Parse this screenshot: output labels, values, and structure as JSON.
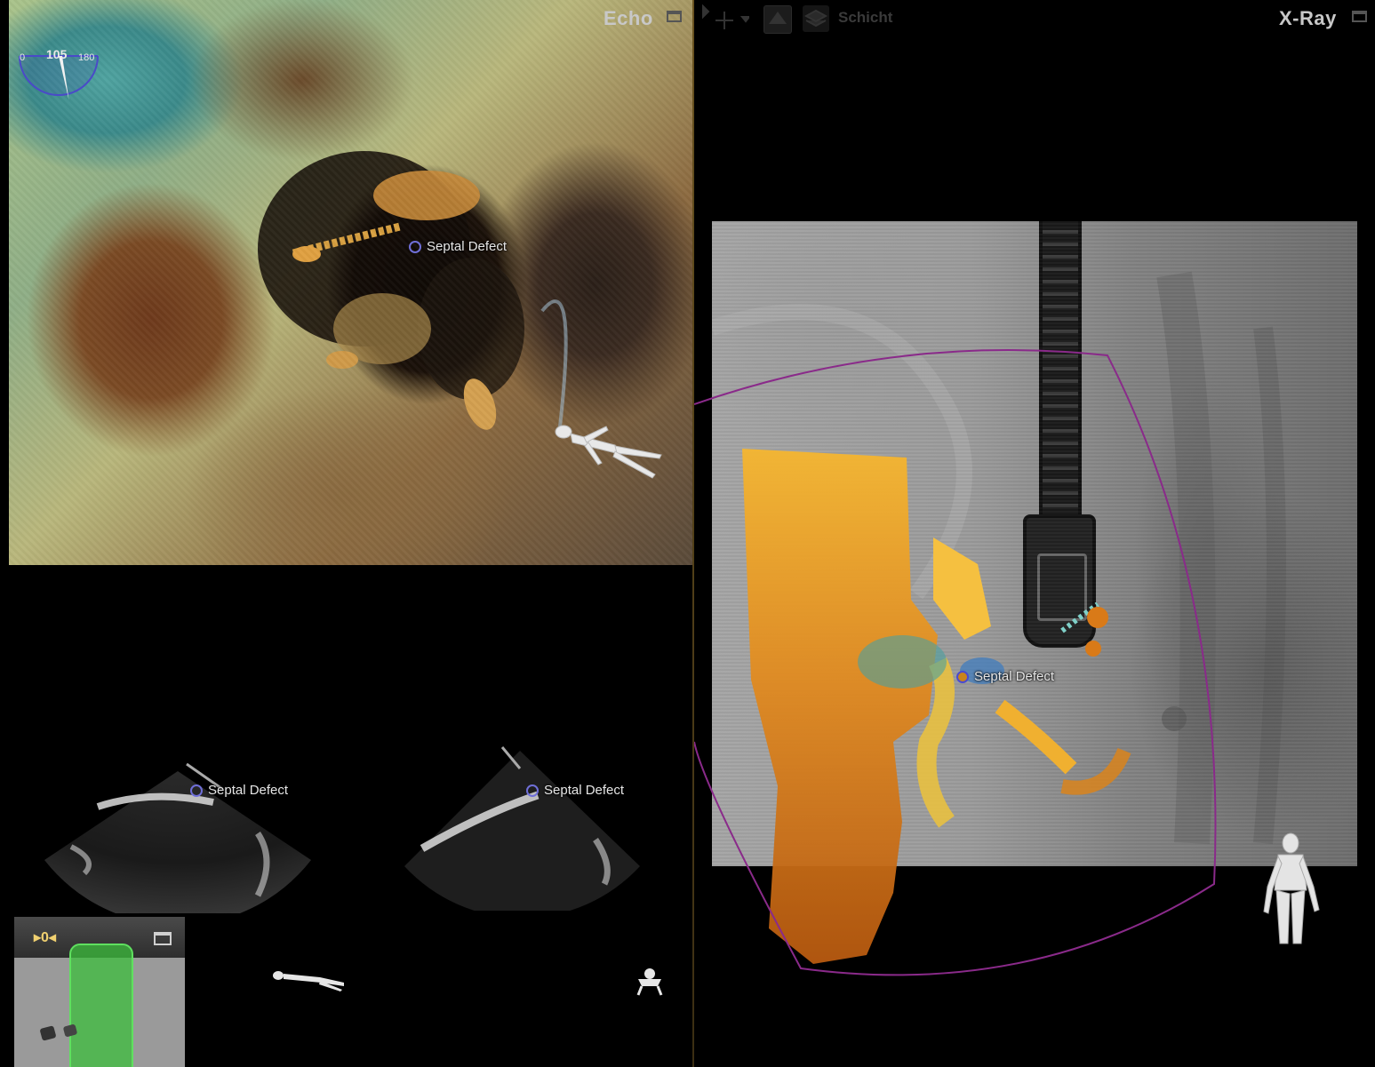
{
  "echo_panel": {
    "title": "Echo",
    "angle_gauge": {
      "min_label": "0",
      "value_label": "105",
      "max_label": "180",
      "value": 105
    },
    "volume_marker_label": "Septal Defect",
    "sector_left_marker_label": "Septal Defect",
    "sector_right_marker_label": "Septal Defect",
    "mini_view": {
      "label": "▸0◂"
    }
  },
  "xray_panel": {
    "title": "X-Ray",
    "toolbar": {
      "layer_label": "Schicht"
    },
    "marker_label": "Septal Defect"
  },
  "colors": {
    "accent_divider": "#6a5320",
    "marker_ring": "#6f6fd8",
    "fov_outline": "#8a2a8a",
    "device_green": "#5fe05f"
  },
  "icons": [
    "move-icon",
    "maximize-icon",
    "layer-icon",
    "body-orientation-icon",
    "marker-icon"
  ]
}
